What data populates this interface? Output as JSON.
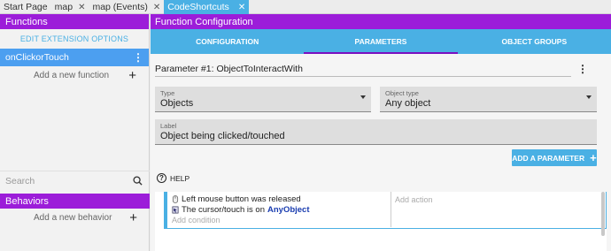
{
  "tabs": [
    {
      "label": "Start Page",
      "closable": false,
      "active": false
    },
    {
      "label": "map",
      "closable": true,
      "active": false
    },
    {
      "label": "map (Events)",
      "closable": true,
      "active": false
    },
    {
      "label": "CodeShortcuts",
      "closable": true,
      "active": true
    }
  ],
  "left": {
    "functions_header": "Functions",
    "edit_extension": "EDIT EXTENSION OPTIONS",
    "selected_function": "onClickorTouch",
    "add_function": "Add a new function",
    "search_placeholder": "Search",
    "behaviors_header": "Behaviors",
    "add_behavior": "Add a new behavior"
  },
  "right": {
    "header": "Function Configuration",
    "subtabs": [
      "CONFIGURATION",
      "PARAMETERS",
      "OBJECT GROUPS"
    ],
    "active_subtab": "PARAMETERS",
    "parameter_title": "Parameter #1: ObjectToInteractWith",
    "type_label": "Type",
    "type_value": "Objects",
    "object_type_label": "Object type",
    "object_type_value": "Any object",
    "label_label": "Label",
    "label_value": "Object being clicked/touched",
    "add_parameter": "ADD A PARAMETER",
    "help": "HELP"
  },
  "events": {
    "conditions": [
      {
        "text": "Left mouse button was released",
        "object": "",
        "icon": "mouse-icon"
      },
      {
        "text": "The cursor/touch is on",
        "object": "AnyObject",
        "icon": "cursor-touch-icon"
      }
    ],
    "add_condition": "Add condition",
    "add_action": "Add action"
  },
  "colors": {
    "purple": "#9c1dd9",
    "blue": "#4ab0e4",
    "selected": "#4c9ff0"
  }
}
